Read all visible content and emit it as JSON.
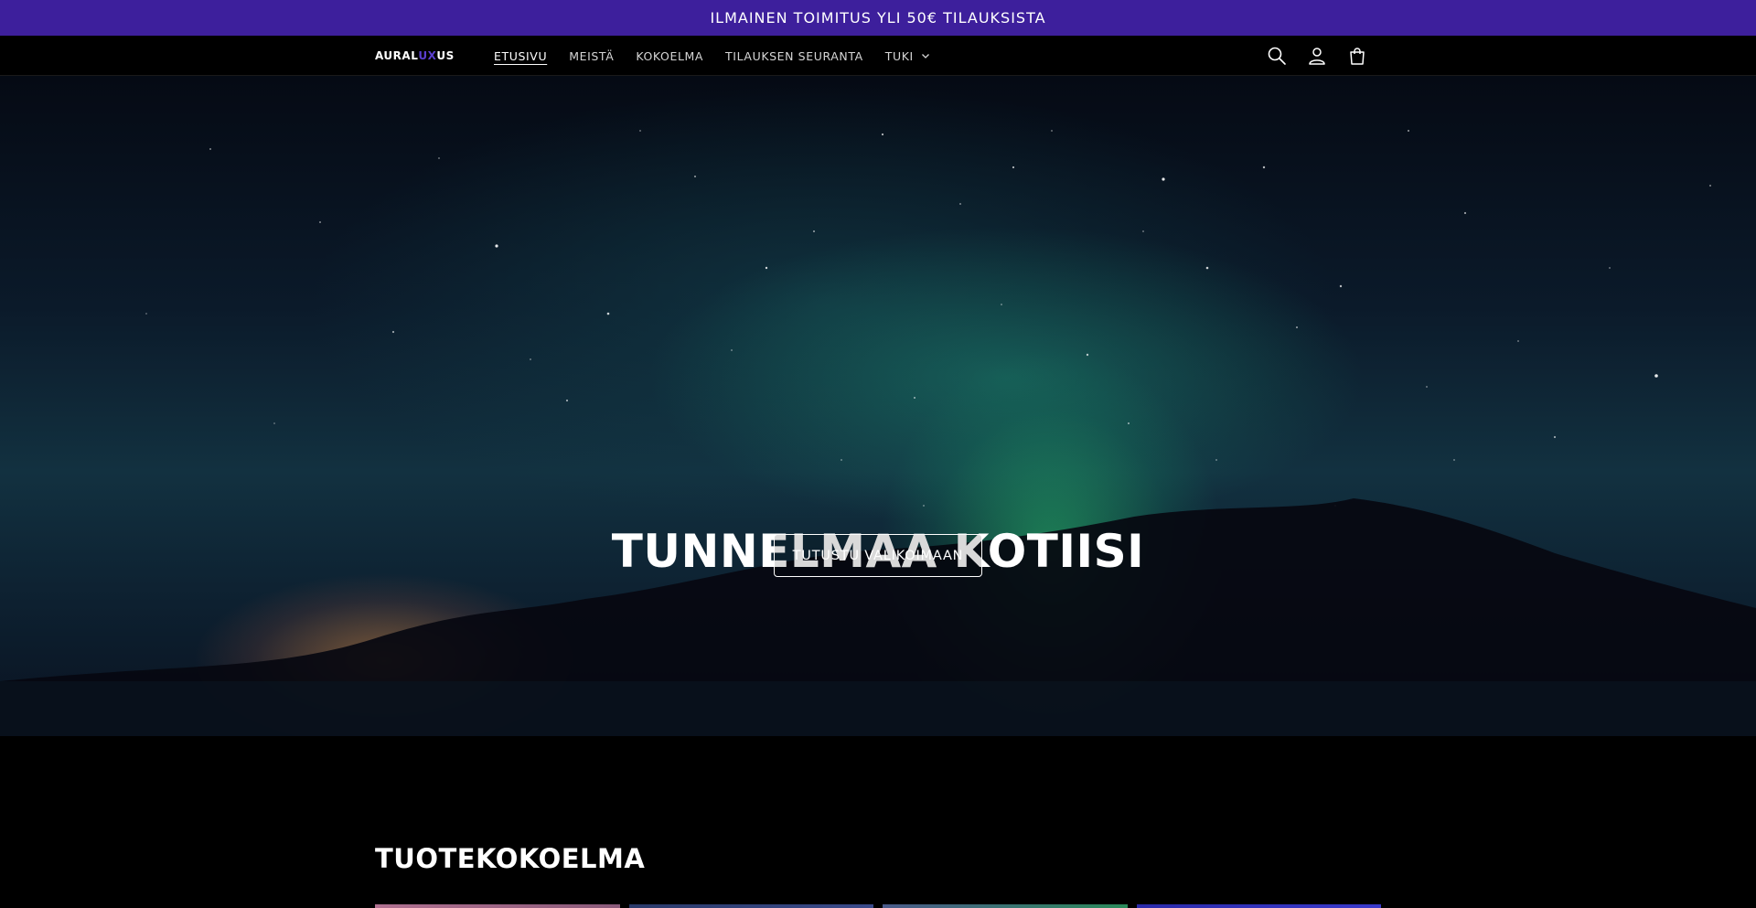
{
  "announcement": {
    "text": "ILMAINEN TOIMITUS YLI 50€ TILAUKSISTA",
    "bg": "#3d1f9c"
  },
  "header": {
    "logo": {
      "part1": "AURAL",
      "part2": "UX",
      "part3": "US"
    },
    "nav": [
      {
        "label": "ETUSIVU",
        "active": true
      },
      {
        "label": "MEISTÄ"
      },
      {
        "label": "KOKOELMA"
      },
      {
        "label": "TILAUKSEN SEURANTA"
      },
      {
        "label": "TUKI",
        "has_dropdown": true
      }
    ],
    "icons": [
      "search-icon",
      "account-icon",
      "cart-icon"
    ]
  },
  "hero": {
    "title": "TUNNELMAA KOTIISI",
    "button_label": "TUTUSTU VALIKOIMAAN"
  },
  "collection": {
    "title": "TUOTEKOKOELMA"
  },
  "colors": {
    "accent": "#5b3fd0",
    "background": "#000000"
  }
}
